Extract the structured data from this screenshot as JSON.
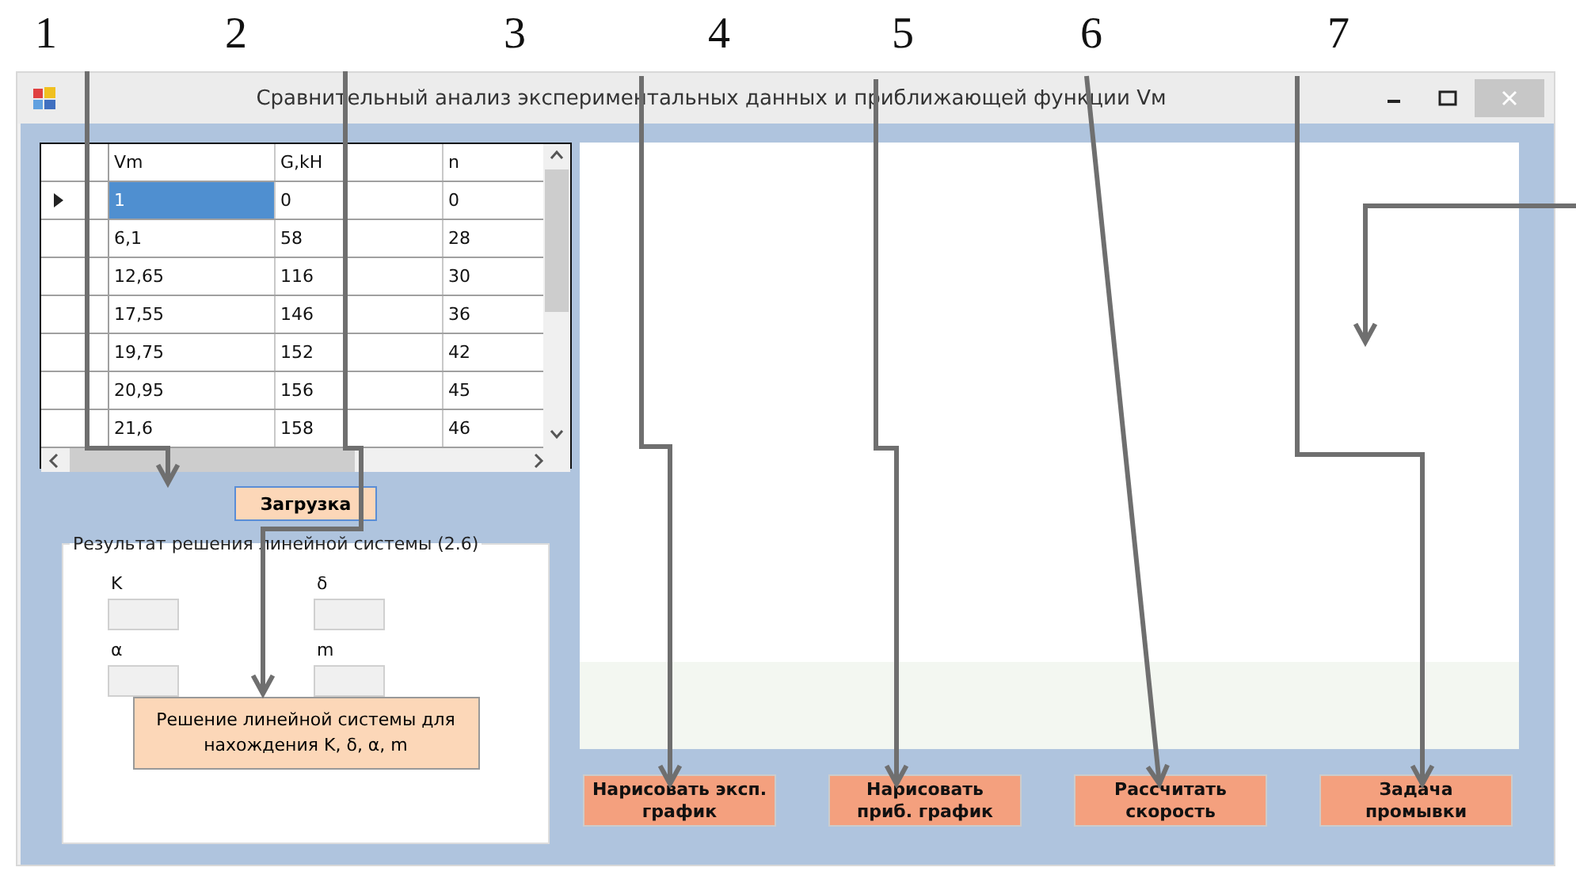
{
  "callouts": [
    {
      "label": "1"
    },
    {
      "label": "2"
    },
    {
      "label": "3"
    },
    {
      "label": "4"
    },
    {
      "label": "5"
    },
    {
      "label": "6"
    },
    {
      "label": "7"
    }
  ],
  "window": {
    "title": "Сравнительный анализ экспериментальных данных и приближающей функции Vм"
  },
  "table": {
    "columns": [
      "Vm",
      "G,kH",
      "n"
    ],
    "rows": [
      {
        "cells": [
          "1",
          "0",
          "0"
        ],
        "selected": true
      },
      {
        "cells": [
          "6,1",
          "58",
          "28"
        ],
        "selected": false
      },
      {
        "cells": [
          "12,65",
          "116",
          "30"
        ],
        "selected": false
      },
      {
        "cells": [
          "17,55",
          "146",
          "36"
        ],
        "selected": false
      },
      {
        "cells": [
          "19,75",
          "152",
          "42"
        ],
        "selected": false
      },
      {
        "cells": [
          "20,95",
          "156",
          "45"
        ],
        "selected": false
      },
      {
        "cells": [
          "21,6",
          "158",
          "46"
        ],
        "selected": false
      }
    ]
  },
  "load_button": "Загрузка",
  "result_group": {
    "title": "Результат решения линейной системы (2.6)",
    "fields": [
      {
        "label": "K"
      },
      {
        "label": "δ"
      },
      {
        "label": "α"
      },
      {
        "label": "m"
      }
    ],
    "solve_button": "Решение линейной системы для нахождения K, δ, α, m"
  },
  "action_buttons": [
    "Нарисовать эксп. график",
    "Нарисовать приб. график",
    "Рассчитать скорость",
    "Задача промывки"
  ]
}
